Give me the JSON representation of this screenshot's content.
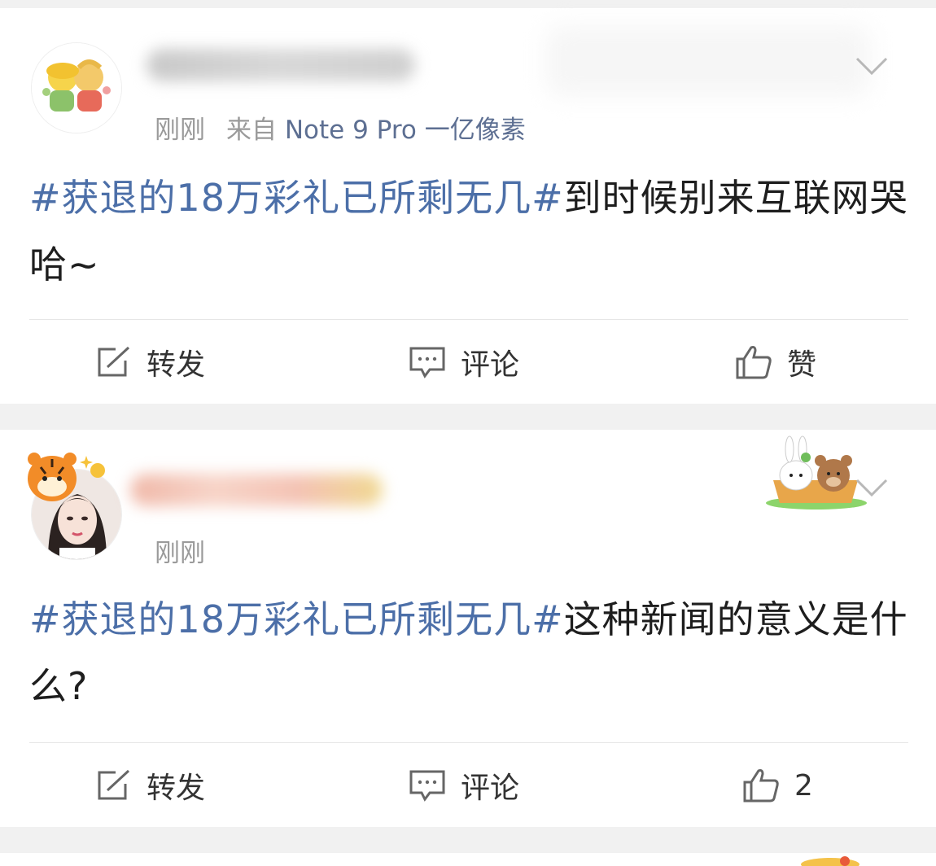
{
  "posts": [
    {
      "time": "刚刚",
      "source": "来自",
      "device": "Note 9 Pro 一亿像素",
      "topic": "#获退的18万彩礼已所剩无几#",
      "text": "到时候别来互联网哭哈~",
      "actions": {
        "repost": "转发",
        "comment": "评论",
        "like": "赞"
      }
    },
    {
      "time": "刚刚",
      "topic": "#获退的18万彩礼已所剩无几#",
      "text": "这种新闻的意义是什么?",
      "actions": {
        "repost": "转发",
        "comment": "评论",
        "like": "2"
      }
    }
  ],
  "colors": {
    "topic": "#4c6fa8",
    "meta": "#9a9a9a",
    "device": "#5d6f92",
    "background": "#f1f1f1"
  },
  "icons": [
    "avatar",
    "chevron-down-icon",
    "repost-icon",
    "comment-icon",
    "like-icon",
    "sticker"
  ]
}
